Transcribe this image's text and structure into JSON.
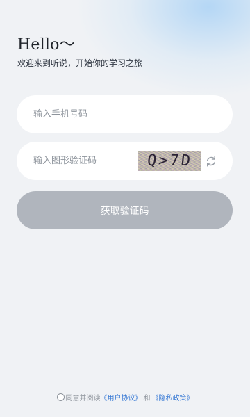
{
  "header": {
    "greeting": "Hello～",
    "subtitle": "欢迎来到听说，开始你的学习之旅"
  },
  "phone_input": {
    "placeholder": "输入手机号码",
    "value": ""
  },
  "captcha_input": {
    "placeholder": "输入图形验证码",
    "value": "",
    "captcha_text": "Q>7D",
    "refresh_icon": "refresh-icon"
  },
  "get_code_button": {
    "label": "获取验证码",
    "state": "disabled",
    "color": "#b0b5bd"
  },
  "agreement": {
    "prefix": "同意并阅读",
    "user_agreement": "《用户协议》",
    "and": "和",
    "privacy_policy": "《隐私政策》",
    "checked": false,
    "link_color": "#3a7bd5"
  }
}
